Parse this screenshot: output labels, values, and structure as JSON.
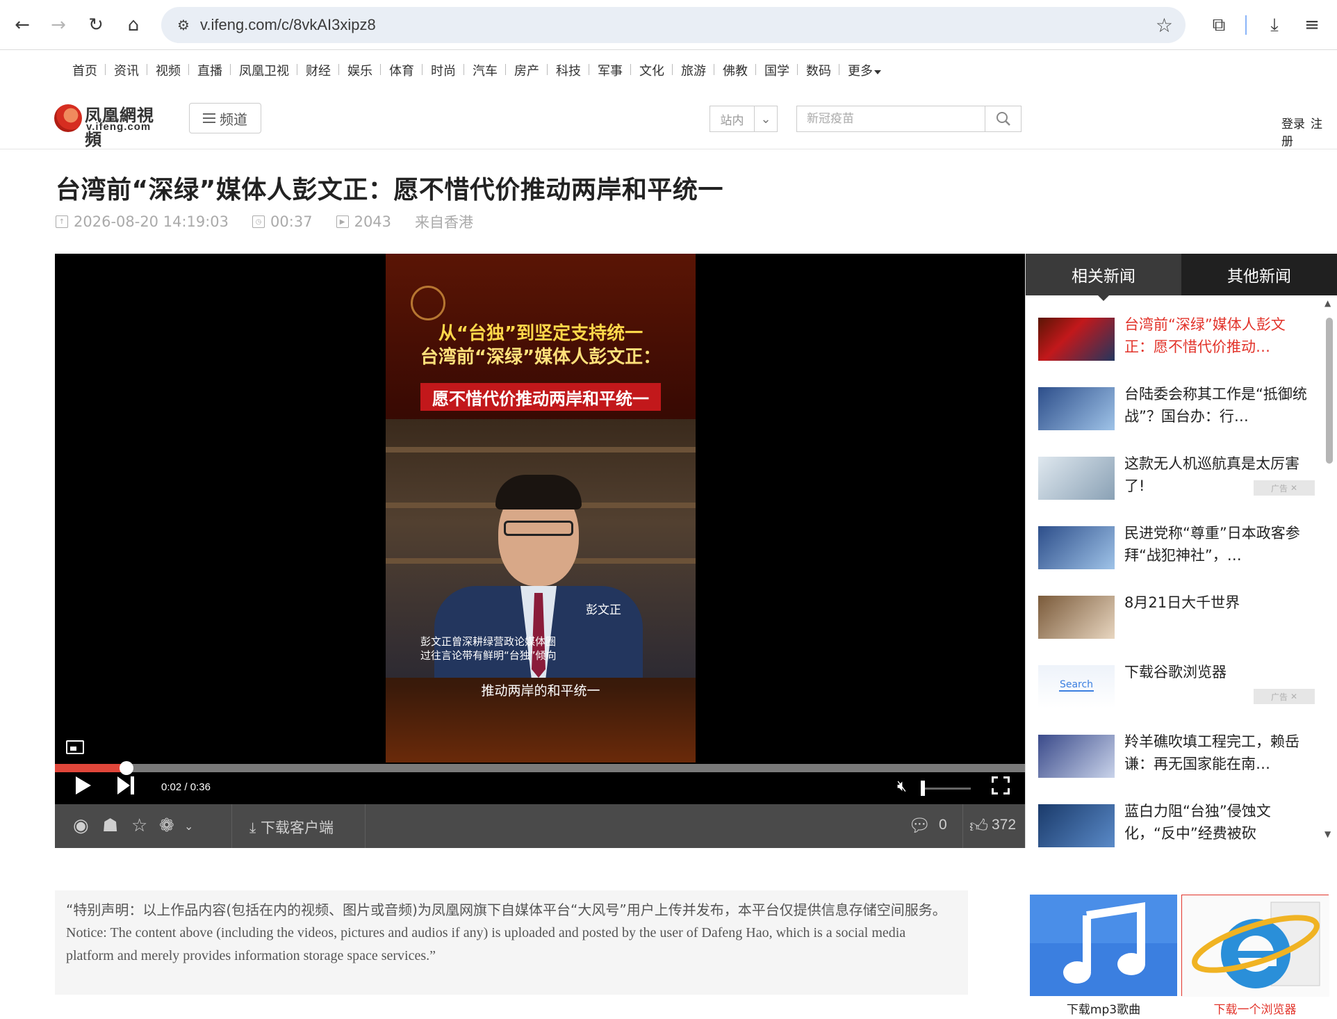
{
  "browser": {
    "url": "v.ifeng.com/c/8vkAI3xipz8"
  },
  "channel_nav": [
    "首页",
    "资讯",
    "视频",
    "直播",
    "凤凰卫视",
    "财经",
    "娱乐",
    "体育",
    "时尚",
    "汽车",
    "房产",
    "科技",
    "军事",
    "文化",
    "旅游",
    "佛教",
    "国学",
    "数码",
    "更多"
  ],
  "header": {
    "logo_cn": "凤凰網視頻",
    "logo_en": "v.ifeng.com",
    "channel_button": "频道",
    "search_scope": "站内",
    "search_placeholder": "新冠疫苗",
    "login": "登录",
    "register": "注册"
  },
  "article": {
    "title": "台湾前“深绿”媒体人彭文正：愿不惜代价推动两岸和平统一",
    "published": "2026-08-20 14:19:03",
    "duration": "00:37",
    "plays": "2043",
    "source": "来自香港"
  },
  "video": {
    "overlay_line1": "从“台独”到坚定支持统一",
    "overlay_line2": "台湾前“深绿”媒体人彭文正：",
    "overlay_banner": "愿不惜代价推动两岸和平统一",
    "speaker_name": "彭文正",
    "caption_line1": "彭文正曾深耕绿营政论媒体圈",
    "caption_line2": "过往言论带有鲜明“台独”倾向",
    "subtitle": "推动两岸的和平统一",
    "current_time": "0:02",
    "total_time": "0:36",
    "progress_fraction": 0.074,
    "volume_fraction": 0.0
  },
  "share_bar": {
    "download_client": "下载客户端",
    "comment_count": "0",
    "like_count": "372"
  },
  "sidebar": {
    "tabs": [
      "相关新闻",
      "其他新闻"
    ],
    "items": [
      {
        "text": "台湾前“深绿”媒体人彭文正：愿不惜代价推动…",
        "highlight": true,
        "ad": false
      },
      {
        "text": "台陆委会称其工作是“抵御统战”？国台办：行…",
        "highlight": false,
        "ad": false
      },
      {
        "text": "这款无人机巡航真是太厉害了!",
        "highlight": false,
        "ad": true
      },
      {
        "text": "民进党称“尊重”日本政客参拜“战犯神社”，…",
        "highlight": false,
        "ad": false
      },
      {
        "text": "8月21日大千世界",
        "highlight": false,
        "ad": false
      },
      {
        "text": "下载谷歌浏览器",
        "highlight": false,
        "ad": true
      },
      {
        "text": "羚羊礁吹填工程完工，赖岳谦：再无国家能在南…",
        "highlight": false,
        "ad": false
      },
      {
        "text": "蓝白力阻“台独”侵蚀文化，“反中”经费被砍",
        "highlight": false,
        "ad": false
      }
    ],
    "ad_label": "广告",
    "search_thumb_text": "Search"
  },
  "disclaimer": {
    "cn": "“特别声明：以上作品内容(包括在内的视频、图片或音频)为凤凰网旗下自媒体平台“大风号”用户上传并发布，本平台仅提供信息存储空间服务。",
    "en": "Notice: The content above (including the videos, pictures and audios if any) is uploaded and posted by the user of Dafeng Hao, which is a social media platform and merely provides information storage space services.”"
  },
  "bottom_ads": [
    {
      "label": "下载mp3歌曲",
      "icon": "music-note-icon"
    },
    {
      "label": "下载一个浏览器",
      "icon": "browser-e-icon"
    }
  ],
  "colors": {
    "accent_red": "#e2332a",
    "progress_red": "#e0463a",
    "banner_red": "#c2181b",
    "overlay_yellow": "#ffd84a"
  }
}
